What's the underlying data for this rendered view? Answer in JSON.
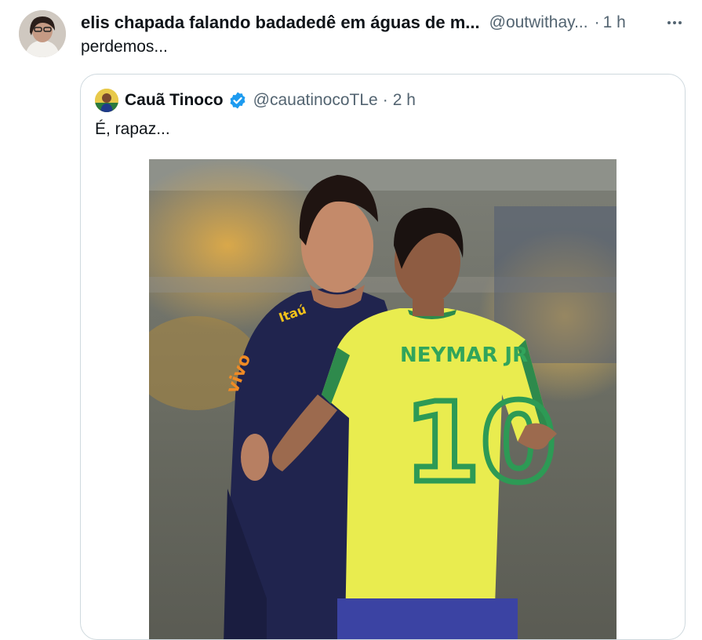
{
  "tweet": {
    "author_name": "elis chapada falando badadedê em águas de m...",
    "author_handle": "@outwithay...",
    "separator": "·",
    "time": "1 h",
    "text": "perdemos..."
  },
  "quoted_tweet": {
    "author_name": "Cauã Tinoco",
    "author_handle": "@cauatinocoTLe",
    "separator": "·",
    "time": "2 h",
    "text": "É, rapaz...",
    "verified_color": "#1d9bf0",
    "image": {
      "jersey_name": "NEYMAR JR",
      "jersey_number": "10",
      "sponsor_text": "Itaú",
      "sponsor2_text": "vivo"
    }
  },
  "icons": {
    "more": "more-horizontal-icon",
    "verified": "verified-badge-icon"
  }
}
